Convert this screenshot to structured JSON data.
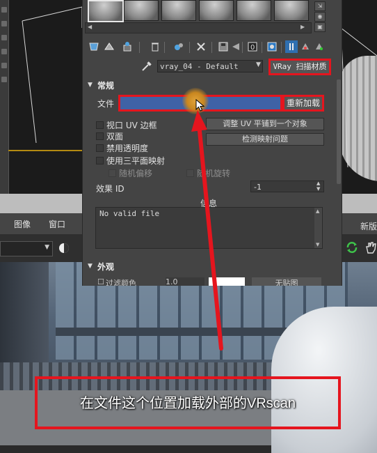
{
  "menubar": {
    "items": [
      "图像",
      "窗口"
    ],
    "right_label": "新版"
  },
  "material_editor": {
    "material_name": "vray_04 - Default",
    "material_type_button": "VRay 扫描材质",
    "section_general": {
      "title": "常规",
      "file_label": "文件",
      "file_value": "",
      "reload_button": "重新加载",
      "checkboxes": {
        "viewport_uv_border": "视口 UV 边框",
        "two_sided": "双面",
        "disable_opacity": "禁用透明度",
        "triplanar": "使用三平面映射",
        "random_offset": "随机偏移",
        "random_rotation": "随机旋转"
      },
      "buttons": {
        "fit_uv": "调整 UV 平铺到一个对象",
        "detect_mapping": "检测映射问题"
      },
      "effect_id_label": "效果 ID",
      "effect_id_value": "-1",
      "info_label": "信息",
      "info_text": "No valid file"
    },
    "section_appearance": {
      "title": "外观",
      "row_label": "过滤颜色",
      "row_value": "1.0",
      "row_button": "无贴图"
    }
  },
  "annotation": {
    "caption": "在文件这个位置加载外部的VRscan",
    "highlight_color": "#e5151e"
  },
  "colors": {
    "file_field": "#3f62a6",
    "panel": "#444444",
    "cursor_glow": "#e0a33a"
  }
}
